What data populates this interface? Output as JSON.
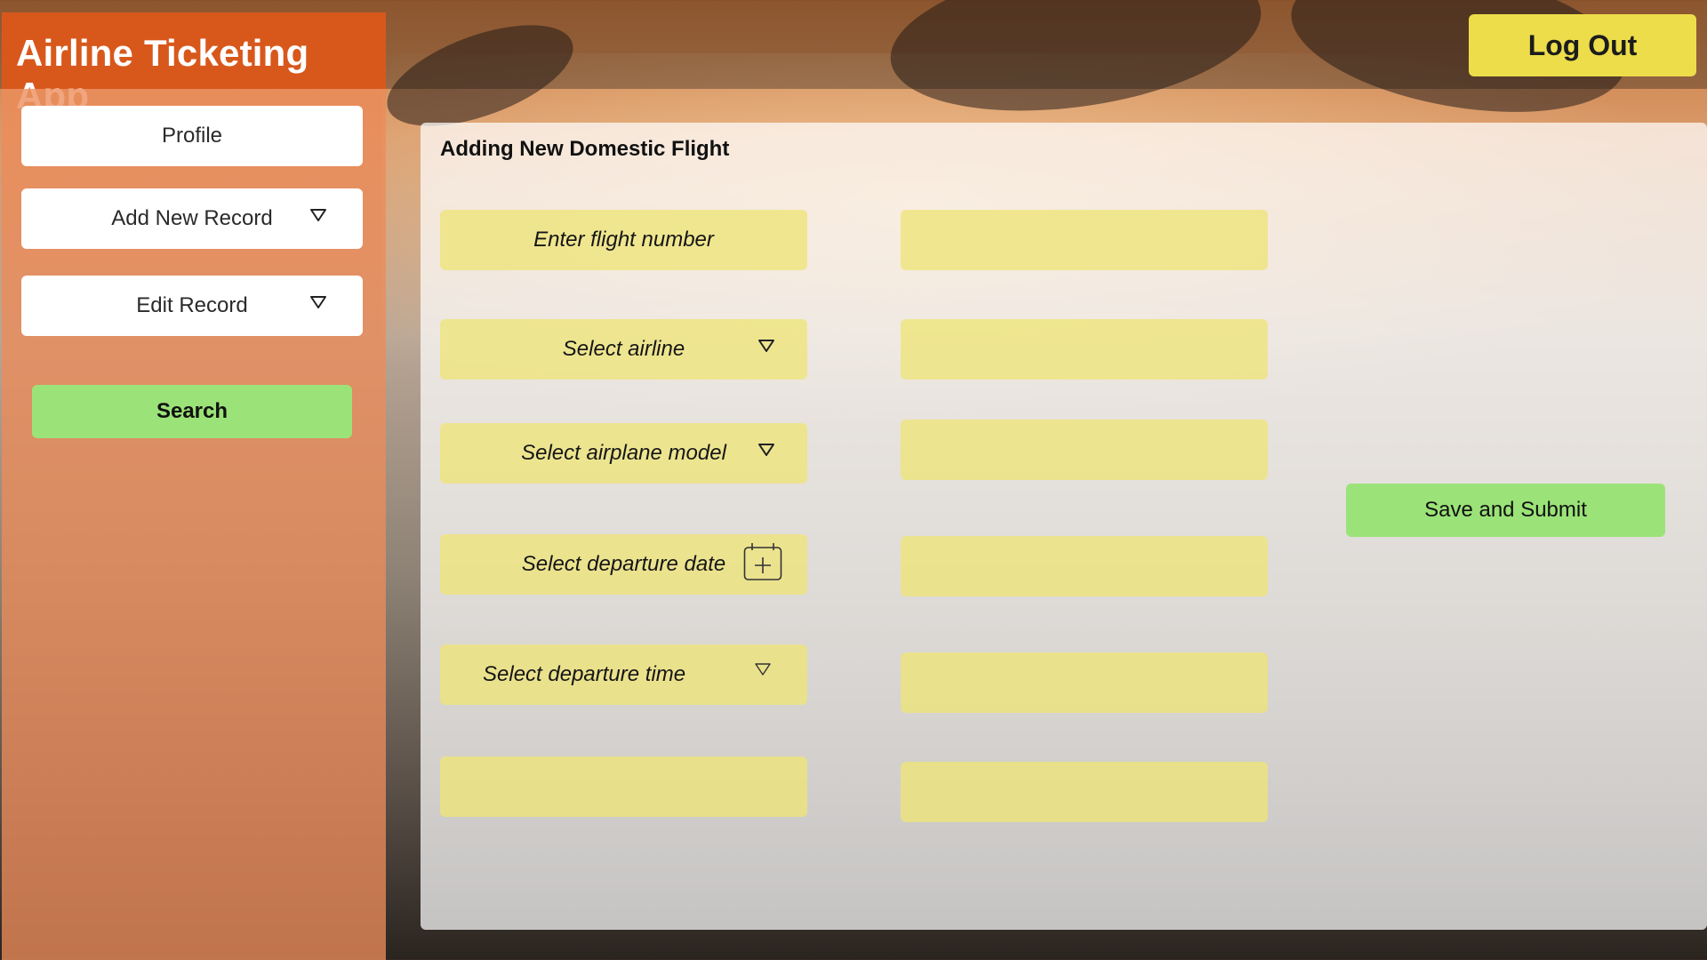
{
  "app": {
    "title": "Airline Ticketing App",
    "logout_label": "Log Out"
  },
  "sidebar": {
    "items": [
      {
        "label": "Profile",
        "has_dropdown": false
      },
      {
        "label": "Add New Record",
        "has_dropdown": true
      },
      {
        "label": "Edit Record",
        "has_dropdown": true
      }
    ],
    "search_label": "Search"
  },
  "form": {
    "title": "Adding New Domestic Flight",
    "left_fields": [
      {
        "placeholder": "Enter flight number",
        "control": "text"
      },
      {
        "placeholder": "Select airline",
        "control": "dropdown",
        "icon": "chevron-down-icon"
      },
      {
        "placeholder": "Select airplane model",
        "control": "dropdown",
        "icon": "chevron-down-icon"
      },
      {
        "placeholder": "Select departure date",
        "control": "date",
        "icon": "calendar-add-icon"
      },
      {
        "placeholder": "Select departure time",
        "control": "dropdown",
        "icon": "chevron-down-icon"
      },
      {
        "placeholder": "",
        "control": "text"
      }
    ],
    "right_fields": [
      "",
      "",
      "",
      "",
      "",
      ""
    ],
    "submit_label": "Save and Submit"
  },
  "colors": {
    "brand": "#d8581c",
    "sidebar": "#ec8c5a",
    "logout": "#eddd4a",
    "action_green": "#9be378",
    "field_yellow": "#eee478"
  }
}
